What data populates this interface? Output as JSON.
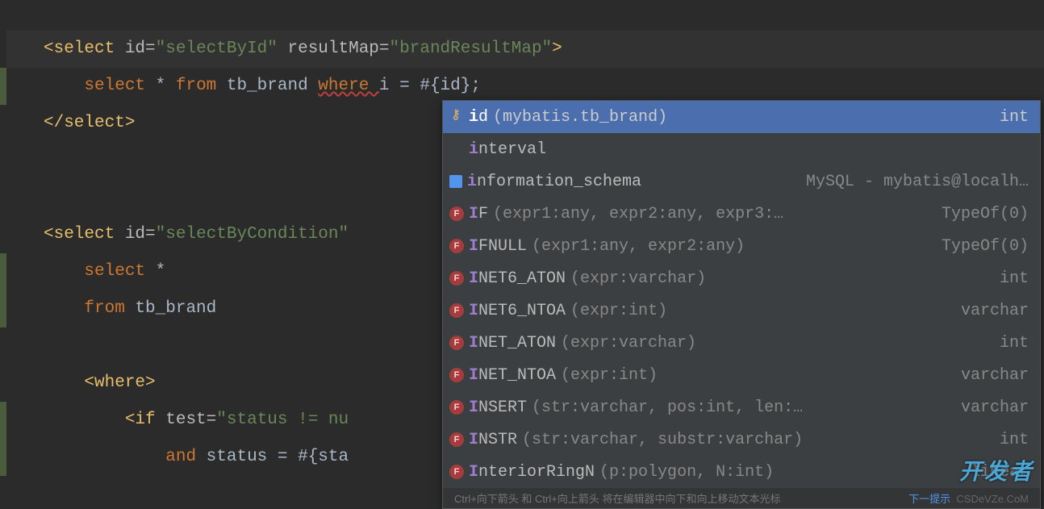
{
  "code": {
    "line1": {
      "full": "<select id=\"selectById\" resultMap=\"brandResultMap\">",
      "tag_open": "<select ",
      "attr1": "id",
      "eq": "=",
      "val1": "\"selectById\"",
      "attr2": " resultMap",
      "val2": "\"brandResultMap\"",
      "tag_close": ">"
    },
    "line2": {
      "kw1": "select ",
      "star": "* ",
      "kw2": "from ",
      "tbl": "tb_brand ",
      "kw3": "where ",
      "col": "i",
      "rest": " = #{id};"
    },
    "line3": "</select>",
    "line4": {
      "tag_open": "<select ",
      "attr1": "id",
      "eq": "=",
      "val1": "\"selectByCondition\""
    },
    "line5": {
      "kw1": "select ",
      "star": "*"
    },
    "line6": {
      "kw1": "from ",
      "tbl": "tb_brand"
    },
    "line7": "<where>",
    "line8": {
      "tag_open": "<if ",
      "attr1": "test",
      "eq": "=",
      "val1": "\"status != nu"
    },
    "line9": {
      "kw1": "and ",
      "col": "status",
      "rest": " = #{sta"
    }
  },
  "completion": {
    "items": [
      {
        "icon": "key",
        "name": "id",
        "hi": "i",
        "signature": " (mybatis.tb_brand)",
        "type": "int"
      },
      {
        "icon": "",
        "name": "interval",
        "hi": "i",
        "signature": "",
        "type": ""
      },
      {
        "icon": "schema",
        "name": "information_schema",
        "hi": "i",
        "signature": "",
        "type": "MySQL - mybatis@localh…"
      },
      {
        "icon": "f",
        "name": "IF",
        "hi": "I",
        "signature": "(expr1:any, expr2:any, expr3:…",
        "type": "TypeOf(0)"
      },
      {
        "icon": "f",
        "name": "IFNULL",
        "hi": "I",
        "signature": "(expr1:any, expr2:any)",
        "type": "TypeOf(0)"
      },
      {
        "icon": "f",
        "name": "INET6_ATON",
        "hi": "I",
        "signature": "(expr:varchar)",
        "type": "int"
      },
      {
        "icon": "f",
        "name": "INET6_NTOA",
        "hi": "I",
        "signature": "(expr:int)",
        "type": "varchar"
      },
      {
        "icon": "f",
        "name": "INET_ATON",
        "hi": "I",
        "signature": "(expr:varchar)",
        "type": "int"
      },
      {
        "icon": "f",
        "name": "INET_NTOA",
        "hi": "I",
        "signature": "(expr:int)",
        "type": "varchar"
      },
      {
        "icon": "f",
        "name": "INSERT",
        "hi": "I",
        "signature": "(str:varchar, pos:int, len:…",
        "type": "varchar"
      },
      {
        "icon": "f",
        "name": "INSTR",
        "hi": "I",
        "signature": "(str:varchar, substr:varchar)",
        "type": "int"
      },
      {
        "icon": "f",
        "name": "InteriorRingN",
        "hi": "I",
        "signature": "(p:polygon, N:int)",
        "type": "linear"
      }
    ],
    "hint": "Ctrl+向下箭头 和 Ctrl+向上箭头 将在编辑器中向下和向上移动文本光标",
    "hint_link": "下一提示"
  },
  "watermark": "开发者",
  "watermark_sub": "CSDeVZe.CoM"
}
